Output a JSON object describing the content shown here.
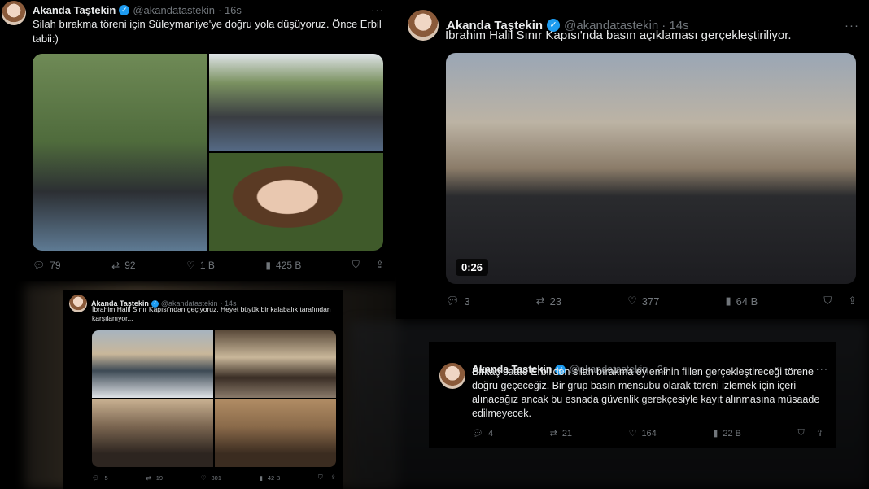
{
  "tweet1": {
    "name": "Akanda Taştekin",
    "handle": "@akandatastekin",
    "time": "· 16s",
    "text": "Silah bırakma töreni için Süleymaniye'ye doğru yola düşüyoruz. Önce Erbil tabii:)",
    "stats": {
      "replies": "79",
      "reposts": "92",
      "likes": "1 B",
      "views": "425 B"
    }
  },
  "tweet2": {
    "name": "Akanda Taştekin",
    "handle": "@akandatastekin",
    "time": "· 14s",
    "text": "İbrahim Halil Sınır Kapısı'nda basın açıklaması gerçekleştiriliyor.",
    "video_duration": "0:26",
    "stats": {
      "replies": "3",
      "reposts": "23",
      "likes": "377",
      "views": "64 B"
    }
  },
  "tweet3": {
    "name": "Akanda Taştekin",
    "handle": "@akandatastekin",
    "time": "· 14s",
    "text": "İbrahim Halil Sınır Kapısı'ndan geçiyoruz. Heyet büyük bir kalabalık tarafından karşılanıyor...",
    "stats": {
      "replies": "5",
      "reposts": "19",
      "likes": "301",
      "views": "42 B"
    }
  },
  "tweet4": {
    "name": "Akanda Taştekin",
    "handle": "@akandatastekin",
    "time": "· 3s",
    "text": "Birkaç saate Erbil'den silah bırakma eyleminin fiilen gerçekleştireceği törene doğru geçeceğiz. Bir grup basın mensubu olarak töreni izlemek için içeri alınacağız ancak bu esnada güvenlik gerekçesiyle kayıt alınmasına müsaade edilmeyecek.",
    "stats": {
      "replies": "4",
      "reposts": "21",
      "likes": "164",
      "views": "22 B"
    }
  },
  "colors": {
    "verified": "#1d9bf0",
    "secondary_text": "#71767b",
    "background": "#000000"
  }
}
